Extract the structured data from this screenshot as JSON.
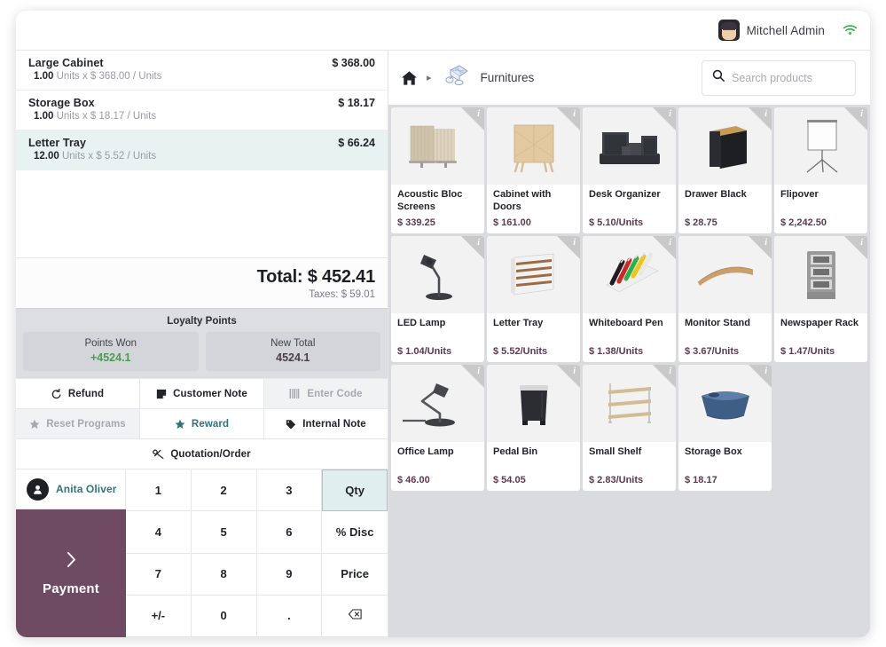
{
  "topbar": {
    "user_name": "Mitchell Admin",
    "avatar_name": "user-avatar",
    "wifi_icon": "wifi-icon"
  },
  "order": {
    "lines": [
      {
        "name": "Large Cabinet",
        "amount": "$ 368.00",
        "qty": "1.00",
        "detail": "Units x $ 368.00 / Units",
        "selected": false
      },
      {
        "name": "Storage Box",
        "amount": "$ 18.17",
        "qty": "1.00",
        "detail": "Units x $ 18.17 / Units",
        "selected": false
      },
      {
        "name": "Letter Tray",
        "amount": "$ 66.24",
        "qty": "12.00",
        "detail": "Units x $ 5.52 / Units",
        "selected": true
      }
    ],
    "total_label": "Total: $ 452.41",
    "taxes_label": "Taxes: $ 59.01"
  },
  "loyalty": {
    "title": "Loyalty Points",
    "cards": [
      {
        "label": "Points Won",
        "value": "+4524.1",
        "accent": "green"
      },
      {
        "label": "New Total",
        "value": "4524.1",
        "accent": "plain"
      }
    ]
  },
  "actions": {
    "row1": [
      {
        "label": "Refund",
        "icon": "refund-icon",
        "state": "normal"
      },
      {
        "label": "Customer Note",
        "icon": "note-icon",
        "state": "normal"
      },
      {
        "label": "Enter Code",
        "icon": "barcode-icon",
        "state": "disabled"
      }
    ],
    "row2": [
      {
        "label": "Reset Programs",
        "icon": "star-icon",
        "state": "disabled"
      },
      {
        "label": "Reward",
        "icon": "star-icon",
        "state": "teal"
      },
      {
        "label": "Internal Note",
        "icon": "tag-icon",
        "state": "normal"
      }
    ],
    "row3": [
      {
        "label": "Quotation/Order",
        "icon": "link-icon",
        "state": "normal"
      }
    ]
  },
  "numpad": {
    "customer_name": "Anita Oliver",
    "payment_label": "Payment",
    "keys": [
      {
        "label": "1",
        "active": false
      },
      {
        "label": "2",
        "active": false
      },
      {
        "label": "3",
        "active": false
      },
      {
        "label": "Qty",
        "active": true
      },
      {
        "label": "4",
        "active": false
      },
      {
        "label": "5",
        "active": false
      },
      {
        "label": "6",
        "active": false
      },
      {
        "label": "% Disc",
        "active": false
      },
      {
        "label": "7",
        "active": false
      },
      {
        "label": "8",
        "active": false
      },
      {
        "label": "9",
        "active": false
      },
      {
        "label": "Price",
        "active": false
      },
      {
        "label": "+/-",
        "active": false
      },
      {
        "label": "0",
        "active": false
      },
      {
        "label": ".",
        "active": false
      },
      {
        "label": "⌫",
        "active": false
      }
    ]
  },
  "breadcrumb": {
    "home_icon": "home-icon",
    "separator": "▸",
    "category": "Furnitures",
    "category_icon": "furniture-category-icon"
  },
  "search": {
    "placeholder": "Search products",
    "value": "",
    "icon": "search-icon"
  },
  "products": [
    {
      "name": "Acoustic Bloc Screens",
      "price": "$ 339.25",
      "img": "screen"
    },
    {
      "name": "Cabinet with Doors",
      "price": "$ 161.00",
      "img": "cabinet"
    },
    {
      "name": "Desk Organizer",
      "price": "$ 5.10/Units",
      "img": "organizer"
    },
    {
      "name": "Drawer Black",
      "price": "$ 28.75",
      "img": "drawer"
    },
    {
      "name": "Flipover",
      "price": "$ 2,242.50",
      "img": "flipover"
    },
    {
      "name": "LED Lamp",
      "price": "$ 1.04/Units",
      "img": "ledlamp"
    },
    {
      "name": "Letter Tray",
      "price": "$ 5.52/Units",
      "img": "lettertray"
    },
    {
      "name": "Whiteboard Pen",
      "price": "$ 1.38/Units",
      "img": "pens"
    },
    {
      "name": "Monitor Stand",
      "price": "$ 3.67/Units",
      "img": "monitorstand"
    },
    {
      "name": "Newspaper Rack",
      "price": "$ 1.47/Units",
      "img": "newsrack"
    },
    {
      "name": "Office Lamp",
      "price": "$ 46.00",
      "img": "officelamp"
    },
    {
      "name": "Pedal Bin",
      "price": "$ 54.05",
      "img": "pedalbin"
    },
    {
      "name": "Small Shelf",
      "price": "$ 2.83/Units",
      "img": "smallshelf"
    },
    {
      "name": "Storage Box",
      "price": "$ 18.17",
      "img": "storagebox"
    }
  ],
  "colors": {
    "payment": "#6f4a63",
    "teal": "#31737a",
    "price": "#5e3a50",
    "selected_line": "#e8f2f1",
    "grid_bg": "#d9dbdf",
    "points_green": "#4f9a52"
  }
}
